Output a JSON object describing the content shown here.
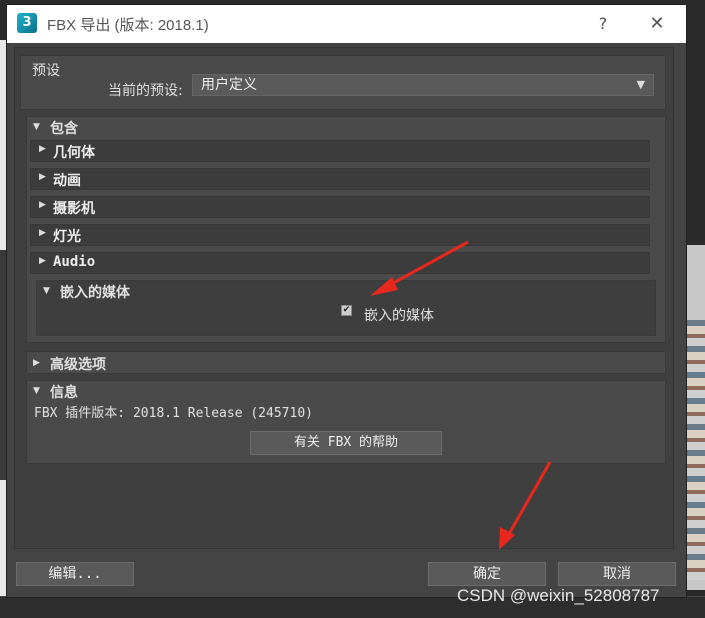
{
  "window": {
    "title": "FBX 导出 (版本: 2018.1)",
    "icon_label": "3",
    "help_glyph": "?",
    "close_glyph": "✕"
  },
  "preset": {
    "section_label": "预设",
    "current_label": "当前的预设:",
    "current_value": "用户定义"
  },
  "include": {
    "section_label": "包含",
    "items": [
      {
        "label": "几何体"
      },
      {
        "label": "动画"
      },
      {
        "label": "摄影机"
      },
      {
        "label": "灯光"
      },
      {
        "label": "Audio"
      }
    ],
    "embedded": {
      "label": "嵌入的媒体",
      "checkbox_label": "嵌入的媒体",
      "checked": true
    }
  },
  "advanced": {
    "section_label": "高级选项"
  },
  "info": {
    "section_label": "信息",
    "plugin_version": "FBX 插件版本: 2018.1 Release (245710)",
    "help_button": "有关 FBX 的帮助"
  },
  "footer": {
    "edit_button": "编辑...",
    "ok_button": "确定",
    "cancel_button": "取消"
  },
  "watermark": "CSDN @weixin_52808787",
  "colors": {
    "annotation_arrow": "#e8281c",
    "dialog_bg": "#444444",
    "panel_bg": "#4a4a4a"
  }
}
